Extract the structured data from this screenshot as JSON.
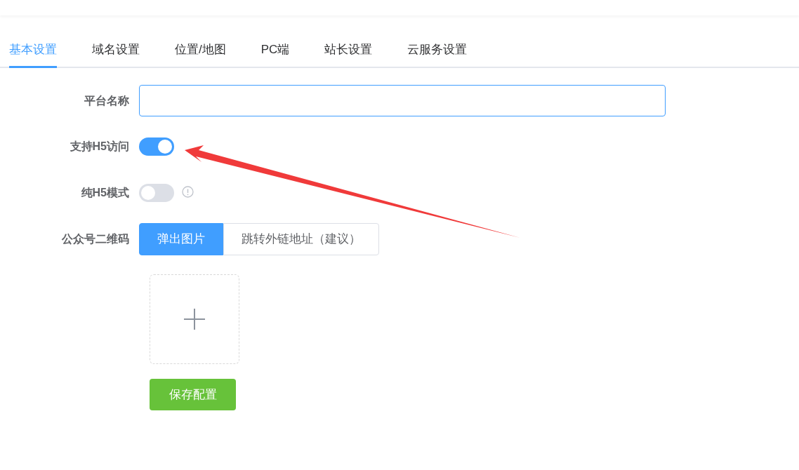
{
  "tabs": [
    {
      "label": "基本设置",
      "selected": true
    },
    {
      "label": "域名设置",
      "selected": false
    },
    {
      "label": "位置/地图",
      "selected": false
    },
    {
      "label": "PC端",
      "selected": false
    },
    {
      "label": "站长设置",
      "selected": false
    },
    {
      "label": "云服务设置",
      "selected": false
    }
  ],
  "form": {
    "platform_name": {
      "label": "平台名称"
    },
    "h5_access": {
      "label": "支持H5访问",
      "on": true
    },
    "pure_h5": {
      "label": "纯H5模式",
      "on": false
    },
    "qr_code": {
      "label": "公众号二维码",
      "options": [
        {
          "label": "弹出图片",
          "selected": true
        },
        {
          "label": "跳转外链地址（建议）",
          "selected": false
        }
      ]
    }
  },
  "save_button": "保存配置"
}
